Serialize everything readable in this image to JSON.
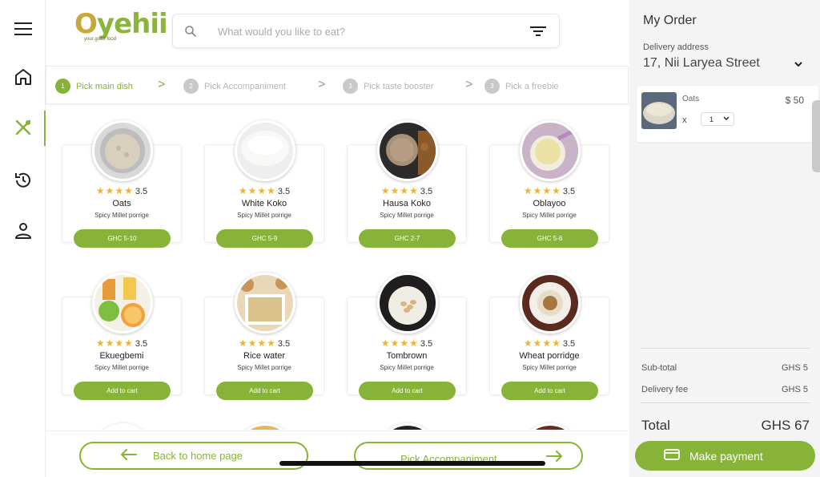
{
  "brand": {
    "name": "yehii",
    "tagline": "your good food",
    "accent": "#86b338"
  },
  "search": {
    "placeholder": "What would you like to eat?"
  },
  "nav": [
    "menu-icon",
    "home-icon",
    "utensils-icon",
    "history-icon",
    "user-icon"
  ],
  "steps": [
    {
      "num": "1",
      "label": "Pick main dish"
    },
    {
      "num": "2",
      "label": "Pick Accompaniment"
    },
    {
      "num": "3",
      "label": "Pick taste booster"
    },
    {
      "num": "3",
      "label": "Pick a freebie"
    }
  ],
  "step_sep": ">",
  "dishes": [
    {
      "name": "Oats",
      "rating": "3.5",
      "desc": "Spicy Millet porrige",
      "button": "GHC 5-10"
    },
    {
      "name": "White Koko",
      "rating": "3.5",
      "desc": "Spicy Millet porrige",
      "button": "GHC 5-9"
    },
    {
      "name": "Hausa Koko",
      "rating": "3.5",
      "desc": "Spicy Millet porrige",
      "button": "GHC 2-7"
    },
    {
      "name": "Oblayoo",
      "rating": "3.5",
      "desc": "Spicy Millet porrige",
      "button": "GHC 5-6"
    },
    {
      "name": "Ekuegbemi",
      "rating": "3.5",
      "desc": "Spicy Millet porrige",
      "button": "Add to cart"
    },
    {
      "name": "Rice water",
      "rating": "3.5",
      "desc": "Spicy Millet porrige",
      "button": "Add to cart"
    },
    {
      "name": "Tombrown",
      "rating": "3.5",
      "desc": "Spicy Millet porrige",
      "button": "Add to cart"
    },
    {
      "name": "Wheat porridge",
      "rating": "3.5",
      "desc": "Spicy Millet porrige",
      "button": "Add to cart"
    }
  ],
  "footer": {
    "back": "Back to home page",
    "next": "Pick Accompaniment"
  },
  "order": {
    "title": "My Order",
    "delivery_label": "Delivery address",
    "address": "17, Nii Laryea Street",
    "item": {
      "name": "Oats",
      "price": "$ 50",
      "x": "x",
      "qty": "1"
    },
    "subtotal_label": "Sub-total",
    "subtotal": "GHS 5",
    "delivery_fee_label": "Delivery fee",
    "delivery_fee": "GHS 5",
    "total_label": "Total",
    "total": "GHS 67",
    "pay": "Make payment"
  }
}
